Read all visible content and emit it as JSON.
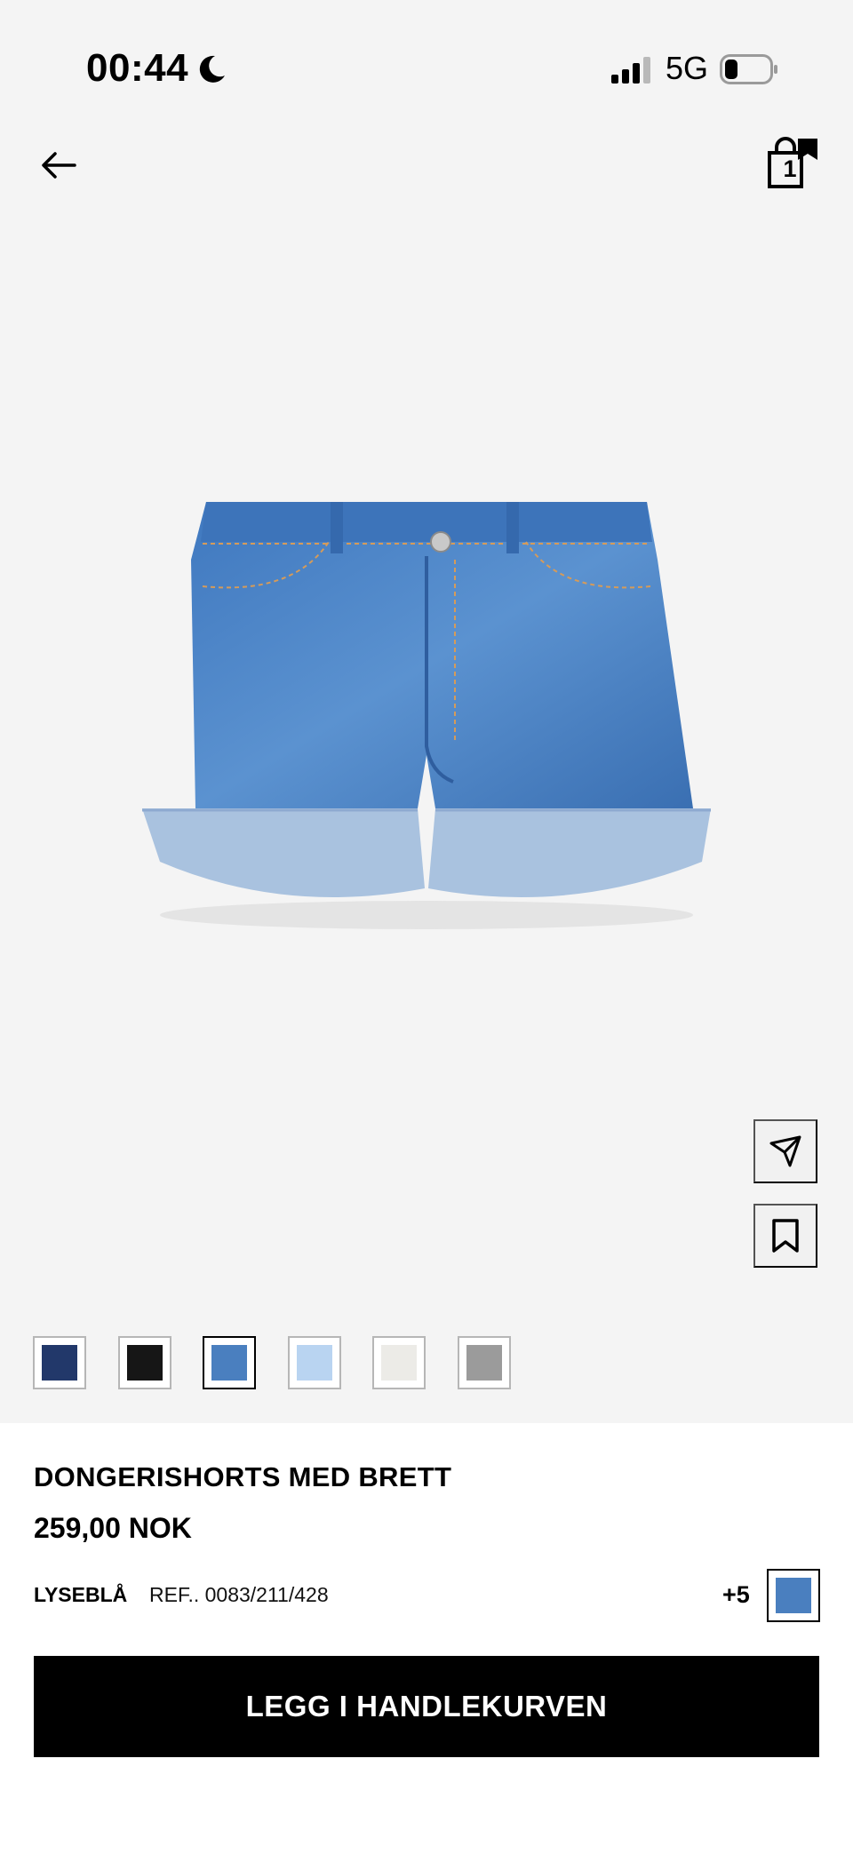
{
  "status_bar": {
    "time": "00:44",
    "network": "5G"
  },
  "header": {
    "back_icon": "arrow-left-icon",
    "bag_icon": "shopping-bag-icon",
    "bag_count": "1"
  },
  "product": {
    "image": "denim-shorts-image",
    "title": "DONGERISHORTS MED BRETT",
    "price": "259,00 NOK",
    "color_name": "LYSEBLÅ",
    "ref": "REF.. 0083/211/428",
    "more_colors": "+5"
  },
  "colors": [
    {
      "hex": "#22386a",
      "selected": false
    },
    {
      "hex": "#161616",
      "selected": false
    },
    {
      "hex": "#4a7fbf",
      "selected": true
    },
    {
      "hex": "#b9d4f1",
      "selected": false
    },
    {
      "hex": "#ecebe7",
      "selected": false
    },
    {
      "hex": "#9b9b9b",
      "selected": false
    }
  ],
  "actions": {
    "share_icon": "send-icon",
    "save_icon": "bookmark-icon",
    "add_to_cart": "LEGG I HANDLEKURVEN"
  }
}
